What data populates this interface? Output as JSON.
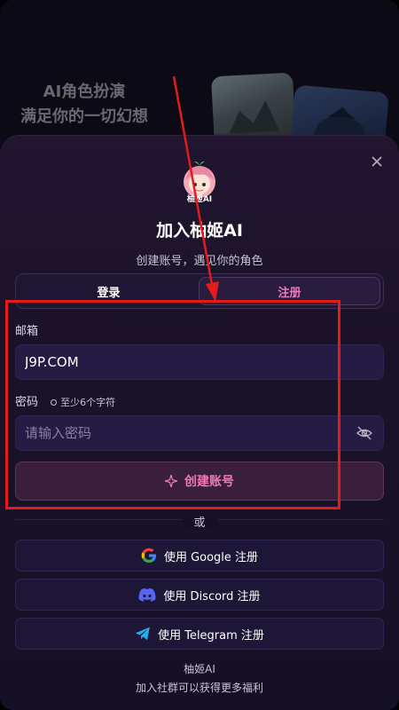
{
  "promo": {
    "line1": "AI角色扮演",
    "line2": "满足你的一切幻想"
  },
  "sheet": {
    "logo_caption": "柚姬AI",
    "title": "加入柚姬AI",
    "subtitle": "创建账号，遇见你的角色",
    "tabs": [
      {
        "label": "登录",
        "active": false
      },
      {
        "label": "注册",
        "active": true
      }
    ],
    "email": {
      "label": "邮箱",
      "value": "J9P.COM"
    },
    "password": {
      "label": "密码",
      "hint": "至少6个字符",
      "placeholder": "请输入密码"
    },
    "create_button": "创建账号",
    "or_label": "或",
    "social": [
      {
        "label": "使用 Google 注册",
        "icon": "google-icon"
      },
      {
        "label": "使用 Discord 注册",
        "icon": "discord-icon"
      },
      {
        "label": "使用 Telegram 注册",
        "icon": "telegram-icon"
      }
    ],
    "footer_name": "柚姬AI",
    "footer_text": "加入社群可以获得更多福利"
  },
  "colors": {
    "accent": "#ee79b8",
    "sheet_bg": "#1a1228",
    "annotation": "#e31b1b"
  }
}
